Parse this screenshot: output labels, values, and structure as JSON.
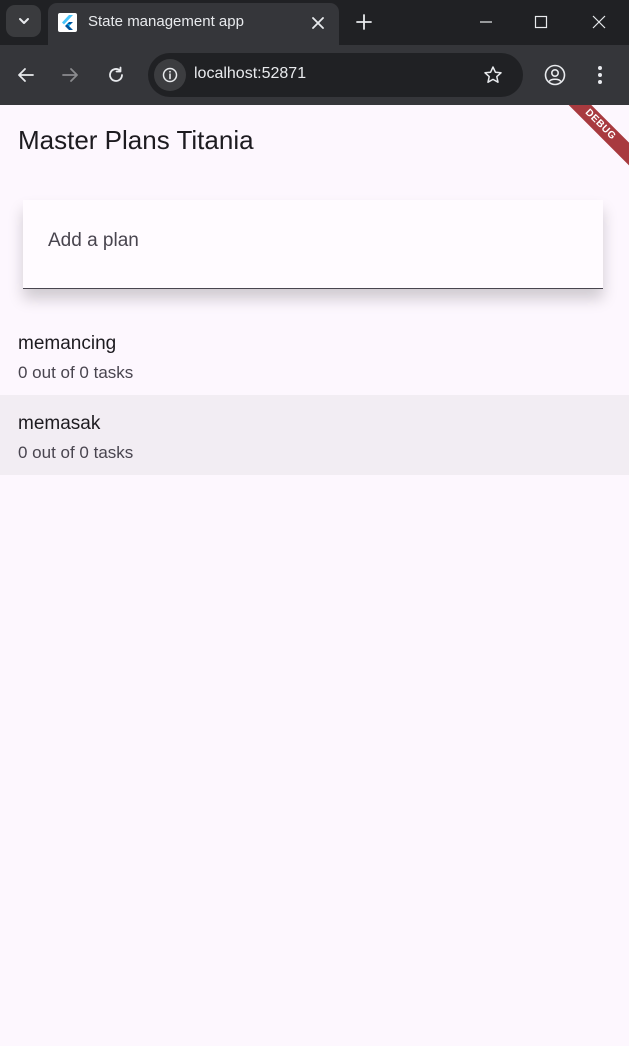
{
  "browser": {
    "tab_title": "State management app",
    "url": "localhost:52871",
    "icons": {
      "tab_search": "chevron-down-icon",
      "favicon": "flutter-icon",
      "tab_close": "close-icon",
      "new_tab": "plus-icon",
      "minimize": "minimize-icon",
      "maximize": "maximize-icon",
      "close_window": "close-icon",
      "back": "arrow-left-icon",
      "forward": "arrow-right-icon",
      "reload": "reload-icon",
      "site_info": "info-icon",
      "bookmark": "star-icon",
      "profile": "profile-icon",
      "menu": "more-vert-icon"
    }
  },
  "app": {
    "title": "Master Plans Titania",
    "debug_banner": "DEBUG",
    "add_plan": {
      "placeholder": "Add a plan",
      "value": ""
    },
    "plans": [
      {
        "name": "memancing",
        "subtitle": "0 out of 0 tasks"
      },
      {
        "name": "memasak",
        "subtitle": "0 out of 0 tasks"
      }
    ],
    "colors": {
      "background": "#fdf7fe",
      "selected_item": "#f2edf3",
      "debug_banner": "#a83a3f"
    }
  }
}
